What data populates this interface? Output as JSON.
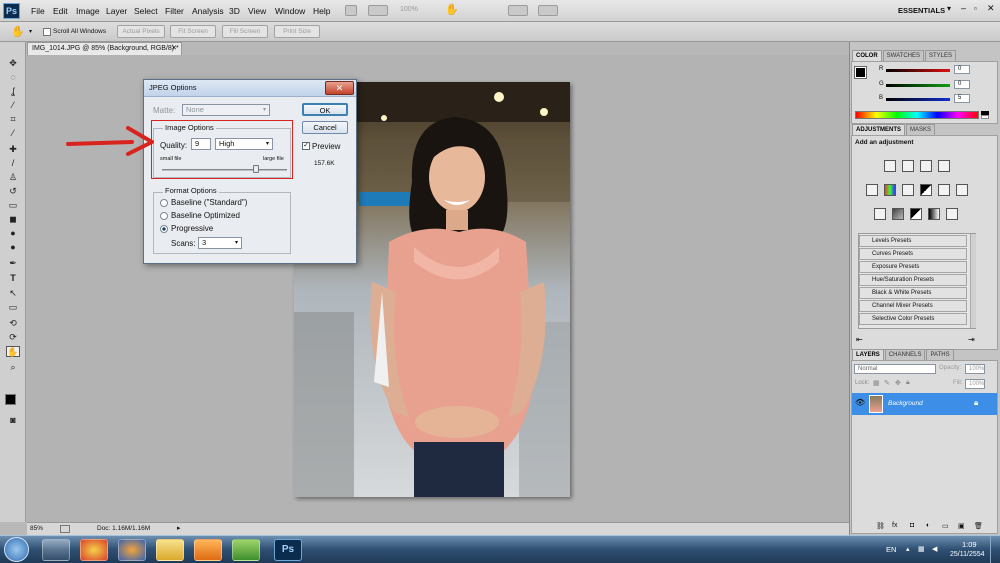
{
  "menubar": {
    "logo": "Ps",
    "items": [
      "File",
      "Edit",
      "Image",
      "Layer",
      "Select",
      "Filter",
      "Analysis",
      "3D",
      "View",
      "Window",
      "Help"
    ],
    "zoom": "100%",
    "workspace": "ESSENTIALS"
  },
  "options": {
    "scroll_all_label": "Scroll All Windows",
    "actual_pixels": "Actual Pixels",
    "fit_screen": "Fit Screen",
    "fill_screen": "Fill Screen",
    "print_size": "Print Size"
  },
  "document": {
    "tab_title": "IMG_1014.JPG @ 85% (Background, RGB/8) *"
  },
  "status": {
    "zoom": "85%",
    "doc_info": "Doc: 1.16M/1.16M"
  },
  "jpeg_dialog": {
    "title": "JPEG Options",
    "close": "✕",
    "matte_label": "Matte:",
    "matte_value": "None",
    "ok": "OK",
    "cancel": "Cancel",
    "preview_label": "Preview",
    "preview_checked": true,
    "image_options_legend": "Image Options",
    "quality_label": "Quality:",
    "quality_value": "9",
    "quality_preset": "High",
    "small_file": "small file",
    "large_file": "large file",
    "quality_slider_fraction": 0.75,
    "file_size": "157.6K",
    "format_options_legend": "Format Options",
    "format_options": [
      {
        "label": "Baseline (\"Standard\")",
        "selected": false
      },
      {
        "label": "Baseline Optimized",
        "selected": false
      },
      {
        "label": "Progressive",
        "selected": true
      }
    ],
    "scans_label": "Scans:",
    "scans_value": "3",
    "highlight_color": "#d9231f"
  },
  "color_panel": {
    "tabs": [
      "COLOR",
      "SWATCHES",
      "STYLES"
    ],
    "channels": [
      {
        "label": "R",
        "value": "0",
        "color": "#e01010"
      },
      {
        "label": "G",
        "value": "0",
        "color": "#10a010"
      },
      {
        "label": "B",
        "value": "5",
        "color": "#1030d0"
      }
    ]
  },
  "adjustments_panel": {
    "tabs": [
      "ADJUSTMENTS",
      "MASKS"
    ],
    "heading": "Add an adjustment",
    "presets": [
      "Levels Presets",
      "Curves Presets",
      "Exposure Presets",
      "Hue/Saturation Presets",
      "Black & White Presets",
      "Channel Mixer Presets",
      "Selective Color Presets"
    ]
  },
  "layers_panel": {
    "tabs": [
      "LAYERS",
      "CHANNELS",
      "PATHS"
    ],
    "blend_mode": "Normal",
    "opacity_label": "Opacity:",
    "opacity_value": "100%",
    "lock_label": "Lock:",
    "fill_label": "Fill:",
    "fill_value": "100%",
    "layer_name": "Background",
    "selected_color": "#3d8ee6"
  },
  "taskbar": {
    "language": "EN",
    "time": "1:09",
    "date": "25/11/2554"
  }
}
